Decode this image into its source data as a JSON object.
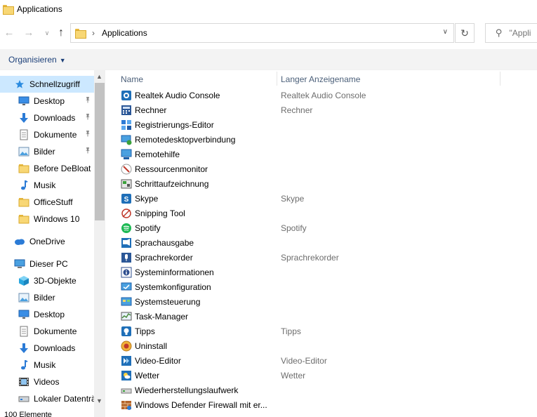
{
  "window": {
    "title": "Applications"
  },
  "address": {
    "path": "Applications",
    "separator": "›"
  },
  "search": {
    "placeholder": "\"Appli"
  },
  "toolbar": {
    "organize_label": "Organisieren"
  },
  "nav": {
    "items": [
      {
        "label": "Schnellzugriff",
        "icon": "star-icon",
        "level": 0,
        "selected": true,
        "pinned": false
      },
      {
        "label": "Desktop",
        "icon": "desktop-icon",
        "level": 1,
        "pinned": true
      },
      {
        "label": "Downloads",
        "icon": "download-arrow-icon",
        "level": 1,
        "pinned": true
      },
      {
        "label": "Dokumente",
        "icon": "documents-icon",
        "level": 1,
        "pinned": true
      },
      {
        "label": "Bilder",
        "icon": "pictures-icon",
        "level": 1,
        "pinned": true
      },
      {
        "label": "Before DeBloat",
        "icon": "folder-icon",
        "level": 1,
        "pinned": false
      },
      {
        "label": "Musik",
        "icon": "music-note-icon",
        "level": 1,
        "pinned": false
      },
      {
        "label": "OfficeStuff",
        "icon": "folder-icon",
        "level": 1,
        "pinned": false
      },
      {
        "label": "Windows 10",
        "icon": "folder-icon",
        "level": 1,
        "pinned": false
      },
      {
        "label": "OneDrive",
        "icon": "cloud-icon",
        "level": 0,
        "pinned": false
      },
      {
        "label": "Dieser PC",
        "icon": "computer-icon",
        "level": 0,
        "pinned": false
      },
      {
        "label": "3D-Objekte",
        "icon": "cube-3d-icon",
        "level": 1,
        "pinned": false
      },
      {
        "label": "Bilder",
        "icon": "pictures-icon",
        "level": 1,
        "pinned": false
      },
      {
        "label": "Desktop",
        "icon": "desktop-icon",
        "level": 1,
        "pinned": false
      },
      {
        "label": "Dokumente",
        "icon": "documents-icon",
        "level": 1,
        "pinned": false
      },
      {
        "label": "Downloads",
        "icon": "download-arrow-icon",
        "level": 1,
        "pinned": false
      },
      {
        "label": "Musik",
        "icon": "music-note-icon",
        "level": 1,
        "pinned": false
      },
      {
        "label": "Videos",
        "icon": "film-icon",
        "level": 1,
        "pinned": false
      },
      {
        "label": "Lokaler Datenträ",
        "icon": "drive-icon",
        "level": 1,
        "pinned": false
      }
    ]
  },
  "columns": {
    "name": "Name",
    "long_name": "Langer Anzeigename"
  },
  "files": [
    {
      "name": "Realtek Audio Console",
      "long_name": "Realtek Audio Console",
      "icon": "realtek-icon",
      "color": "#1f6fb8"
    },
    {
      "name": "Rechner",
      "long_name": "Rechner",
      "icon": "calculator-icon",
      "color": "#2b5797"
    },
    {
      "name": "Registrierungs-Editor",
      "long_name": "",
      "icon": "registry-icon",
      "color": "#2e7bd6"
    },
    {
      "name": "Remotedesktopverbindung",
      "long_name": "",
      "icon": "remote-desktop-icon",
      "color": "#2f6db5"
    },
    {
      "name": "Remotehilfe",
      "long_name": "",
      "icon": "remote-help-icon",
      "color": "#2f6db5"
    },
    {
      "name": "Ressourcenmonitor",
      "long_name": "",
      "icon": "resource-monitor-icon",
      "color": "#c0392b"
    },
    {
      "name": "Schrittaufzeichnung",
      "long_name": "",
      "icon": "steps-recorder-icon",
      "color": "#4a4a4a"
    },
    {
      "name": "Skype",
      "long_name": "Skype",
      "icon": "skype-icon",
      "color": "#1f6fb8"
    },
    {
      "name": "Snipping Tool",
      "long_name": "",
      "icon": "scissors-icon",
      "color": "#c0392b"
    },
    {
      "name": "Spotify",
      "long_name": "Spotify",
      "icon": "spotify-icon",
      "color": "#1db954"
    },
    {
      "name": "Sprachausgabe",
      "long_name": "",
      "icon": "narrator-icon",
      "color": "#1f6fb8"
    },
    {
      "name": "Sprachrekorder",
      "long_name": "Sprachrekorder",
      "icon": "microphone-icon",
      "color": "#2b5797"
    },
    {
      "name": "Systeminformationen",
      "long_name": "",
      "icon": "system-info-icon",
      "color": "#2f4f8f"
    },
    {
      "name": "Systemkonfiguration",
      "long_name": "",
      "icon": "system-config-icon",
      "color": "#2f6db5"
    },
    {
      "name": "Systemsteuerung",
      "long_name": "",
      "icon": "control-panel-icon",
      "color": "#2f6db5"
    },
    {
      "name": "Task-Manager",
      "long_name": "",
      "icon": "task-manager-icon",
      "color": "#4a8a3a"
    },
    {
      "name": "Tipps",
      "long_name": "Tipps",
      "icon": "lightbulb-icon",
      "color": "#1f6fb8"
    },
    {
      "name": "Uninstall",
      "long_name": "",
      "icon": "uninstall-icon",
      "color": "#c0392b"
    },
    {
      "name": "Video-Editor",
      "long_name": "Video-Editor",
      "icon": "video-editor-icon",
      "color": "#1f6fb8"
    },
    {
      "name": "Wetter",
      "long_name": "Wetter",
      "icon": "weather-icon",
      "color": "#1f6fb8"
    },
    {
      "name": "Wiederherstellungslaufwerk",
      "long_name": "",
      "icon": "recovery-drive-icon",
      "color": "#777777"
    },
    {
      "name": "Windows Defender Firewall mit er...",
      "long_name": "",
      "icon": "firewall-icon",
      "color": "#8a5a2b"
    }
  ],
  "status": {
    "count_text": "100 Elemente"
  }
}
